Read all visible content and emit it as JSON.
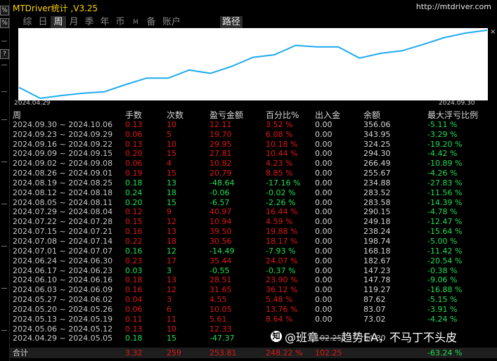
{
  "title": "MTDriver统计 ,V3.25",
  "url": "http://mtdriver.com",
  "leftbar": {
    "btn1": "%",
    "btn2": "%",
    "btn3": "?"
  },
  "close": "×",
  "tabs": [
    "综",
    "日",
    "周",
    "月",
    "季",
    "年",
    "币",
    "M",
    "备",
    "账户"
  ],
  "active_tab": "周",
  "path_tab": "路径",
  "chart_data": {
    "type": "line",
    "x_start": "2024.04.29",
    "x_end": "2024.09.30",
    "x": [
      "2024.04.29",
      "2024.05.06",
      "2024.05.13",
      "2024.05.20",
      "2024.05.27",
      "2024.06.03",
      "2024.06.10",
      "2024.06.17",
      "2024.06.24",
      "2024.07.01",
      "2024.07.08",
      "2024.07.15",
      "2024.07.22",
      "2024.07.29",
      "2024.08.05",
      "2024.08.12",
      "2024.08.19",
      "2024.08.26",
      "2024.09.02",
      "2024.09.09",
      "2024.09.16",
      "2024.09.23",
      "2024.09.30"
    ],
    "values": [
      54.8,
      7.43,
      19.76,
      29.81,
      35.42,
      67.07,
      95.58,
      95.03,
      130.47,
      115.98,
      146.54,
      186.04,
      196.98,
      237.95,
      231.38,
      231.32,
      182.68,
      203.47,
      214.29,
      242.1,
      272.05,
      291.75,
      303.86
    ],
    "color": "#1eaaf0"
  },
  "table": {
    "headers": [
      "周",
      "手数",
      "次数",
      "盈亏金额",
      "百分比%",
      "出入金",
      "余额",
      "最大浮亏比例"
    ],
    "rows": [
      {
        "week": "2024.09.30 ~ 2024.10.06",
        "lots": "0.13",
        "trades": "10",
        "pnl": "12.11",
        "pct": "3.52 %",
        "dep": "0.00",
        "bal": "356.06",
        "dd": "-5.11 %",
        "sign": "neg"
      },
      {
        "week": "2024.09.23 ~ 2024.09.29",
        "lots": "0.06",
        "trades": "5",
        "pnl": "19.70",
        "pct": "6.08 %",
        "dep": "0.00",
        "bal": "343.95",
        "dd": "-3.29 %",
        "sign": "neg"
      },
      {
        "week": "2024.09.16 ~ 2024.09.22",
        "lots": "0.13",
        "trades": "10",
        "pnl": "29.95",
        "pct": "10.18 %",
        "dep": "0.00",
        "bal": "324.25",
        "dd": "-19.20 %",
        "sign": "neg"
      },
      {
        "week": "2024.09.09 ~ 2024.09.15",
        "lots": "0.20",
        "trades": "15",
        "pnl": "27.81",
        "pct": "10.44 %",
        "dep": "0.00",
        "bal": "294.30",
        "dd": "-4.42 %",
        "sign": "neg"
      },
      {
        "week": "2024.09.02 ~ 2024.09.08",
        "lots": "0.06",
        "trades": "4",
        "pnl": "10.82",
        "pct": "4.23 %",
        "dep": "0.00",
        "bal": "266.49",
        "dd": "-10.89 %",
        "sign": "neg"
      },
      {
        "week": "2024.08.26 ~ 2024.09.01",
        "lots": "0.19",
        "trades": "15",
        "pnl": "20.79",
        "pct": "8.85 %",
        "dep": "0.00",
        "bal": "255.67",
        "dd": "-4.26 %",
        "sign": "neg"
      },
      {
        "week": "2024.08.19 ~ 2024.08.25",
        "lots": "0.18",
        "trades": "13",
        "pnl": "-48.64",
        "pct": "-17.16 %",
        "dep": "0.00",
        "bal": "234.88",
        "dd": "-27.83 %",
        "sign": "pos"
      },
      {
        "week": "2024.08.12 ~ 2024.08.18",
        "lots": "0.24",
        "trades": "18",
        "pnl": "-0.06",
        "pct": "-0.02 %",
        "dep": "0.00",
        "bal": "283.52",
        "dd": "-11.56 %",
        "sign": "pos"
      },
      {
        "week": "2024.08.05 ~ 2024.08.11",
        "lots": "0.20",
        "trades": "15",
        "pnl": "-6.57",
        "pct": "-2.26 %",
        "dep": "0.00",
        "bal": "283.58",
        "dd": "-14.39 %",
        "sign": "pos"
      },
      {
        "week": "2024.07.29 ~ 2024.08.04",
        "lots": "0.12",
        "trades": "9",
        "pnl": "40.97",
        "pct": "16.44 %",
        "dep": "0.00",
        "bal": "290.15",
        "dd": "-4.78 %",
        "sign": "neg"
      },
      {
        "week": "2024.07.22 ~ 2024.07.28",
        "lots": "0.15",
        "trades": "12",
        "pnl": "10.94",
        "pct": "4.59 %",
        "dep": "0.00",
        "bal": "249.18",
        "dd": "-12.47 %",
        "sign": "neg"
      },
      {
        "week": "2024.07.15 ~ 2024.07.21",
        "lots": "0.16",
        "trades": "13",
        "pnl": "39.50",
        "pct": "19.88 %",
        "dep": "0.00",
        "bal": "238.24",
        "dd": "-15.64 %",
        "sign": "neg"
      },
      {
        "week": "2024.07.08 ~ 2024.07.14",
        "lots": "0.22",
        "trades": "18",
        "pnl": "30.56",
        "pct": "18.17 %",
        "dep": "0.00",
        "bal": "198.74",
        "dd": "-5.00 %",
        "sign": "neg"
      },
      {
        "week": "2024.07.01 ~ 2024.07.07",
        "lots": "0.16",
        "trades": "12",
        "pnl": "-14.49",
        "pct": "-7.93 %",
        "dep": "0.00",
        "bal": "168.18",
        "dd": "-11.42 %",
        "sign": "pos"
      },
      {
        "week": "2024.06.24 ~ 2024.06.30",
        "lots": "0.23",
        "trades": "17",
        "pnl": "35.44",
        "pct": "24.07 %",
        "dep": "0.00",
        "bal": "182.67",
        "dd": "-20.54 %",
        "sign": "neg"
      },
      {
        "week": "2024.06.17 ~ 2024.06.23",
        "lots": "0.03",
        "trades": "3",
        "pnl": "-0.55",
        "pct": "-0.37 %",
        "dep": "0.00",
        "bal": "147.23",
        "dd": "-0.38 %",
        "sign": "pos"
      },
      {
        "week": "2024.06.10 ~ 2024.06.16",
        "lots": "0.18",
        "trades": "13",
        "pnl": "28.51",
        "pct": "23.90 %",
        "dep": "0.00",
        "bal": "147.78",
        "dd": "-9.06 %",
        "sign": "neg"
      },
      {
        "week": "2024.06.03 ~ 2024.06.09",
        "lots": "0.16",
        "trades": "12",
        "pnl": "31.65",
        "pct": "36.12 %",
        "dep": "0.00",
        "bal": "119.27",
        "dd": "-16.88 %",
        "sign": "neg"
      },
      {
        "week": "2024.05.27 ~ 2024.06.02",
        "lots": "0.04",
        "trades": "3",
        "pnl": "4.55",
        "pct": "5.48 %",
        "dep": "0.00",
        "bal": "87.62",
        "dd": "-5.15 %",
        "sign": "neg"
      },
      {
        "week": "2024.05.20 ~ 2024.05.26",
        "lots": "0.06",
        "trades": "6",
        "pnl": "10.05",
        "pct": "13.76 %",
        "dep": "0.00",
        "bal": "83.07",
        "dd": "-3.91 %",
        "sign": "neg"
      },
      {
        "week": "2024.05.13 ~ 2024.05.19",
        "lots": "0.11",
        "trades": "11",
        "pnl": "5.61",
        "pct": "8.64 %",
        "dep": "0.00",
        "bal": "73.02",
        "dd": "-4.24 %",
        "sign": "neg"
      },
      {
        "week": "2024.05.06 ~ 2024.05.12",
        "lots": "0.13",
        "trades": "10",
        "pnl": "12.33",
        "pct": "",
        "dep": "",
        "bal": "",
        "dd": "",
        "sign": "neg"
      },
      {
        "week": "2024.04.29 ~ 2024.05.05",
        "lots": "0.18",
        "trades": "15",
        "pnl": "-47.37",
        "pct": "",
        "dep": "102.25",
        "bal": "54.80",
        "dd": "",
        "sign": "pos"
      }
    ],
    "totals": {
      "label": "合计",
      "lots": "3.32",
      "trades": "259",
      "pnl": "253.81",
      "pct": "248.22 %",
      "dep": "102.25",
      "dd": "-63.24 %"
    }
  },
  "watermark": {
    "logo": "知",
    "text": "@班章——趋势EA，不马丁不头皮"
  }
}
